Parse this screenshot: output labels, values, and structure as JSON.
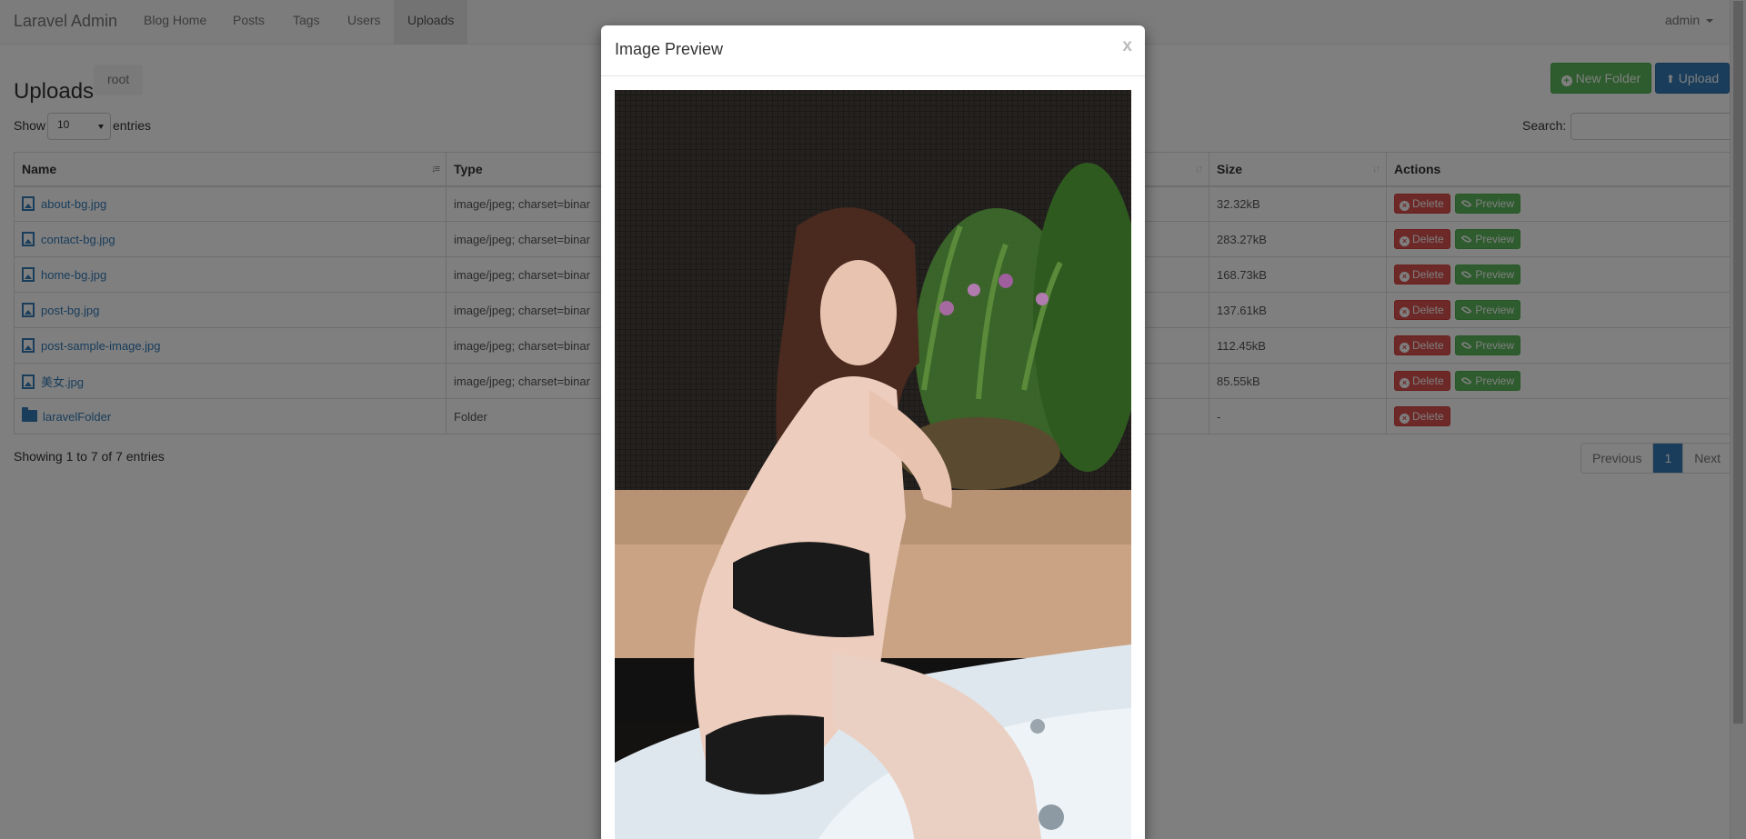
{
  "navbar": {
    "brand": "Laravel Admin",
    "links": [
      "Blog Home",
      "Posts",
      "Tags",
      "Users",
      "Uploads"
    ],
    "user": "admin"
  },
  "page": {
    "title": "Uploads",
    "breadcrumb": "root",
    "new_folder_label": "New Folder",
    "upload_label": "Upload"
  },
  "table_controls": {
    "show_label": "Show",
    "entries_label": "entries",
    "page_length": "10",
    "search_label": "Search:"
  },
  "table": {
    "columns": [
      "Name",
      "Type",
      "Size",
      "Actions"
    ],
    "rows": [
      {
        "name": "about-bg.jpg",
        "type": "image/jpeg; charset=binar",
        "size": "32.32kB"
      },
      {
        "name": "contact-bg.jpg",
        "type": "image/jpeg; charset=binar",
        "size": "283.27kB"
      },
      {
        "name": "home-bg.jpg",
        "type": "image/jpeg; charset=binar",
        "size": "168.73kB"
      },
      {
        "name": "post-bg.jpg",
        "type": "image/jpeg; charset=binar",
        "size": "137.61kB"
      },
      {
        "name": "post-sample-image.jpg",
        "type": "image/jpeg; charset=binar",
        "size": "112.45kB"
      },
      {
        "name": "美女.jpg",
        "type": "image/jpeg; charset=binar",
        "size": "85.55kB"
      },
      {
        "name": "laravelFolder",
        "type": "Folder",
        "size": "-"
      }
    ],
    "delete_label": "Delete",
    "preview_label": "Preview"
  },
  "footer": {
    "info": "Showing 1 to 7 of 7 entries",
    "previous": "Previous",
    "page": "1",
    "next": "Next"
  },
  "modal": {
    "title": "Image Preview",
    "close": "x"
  }
}
